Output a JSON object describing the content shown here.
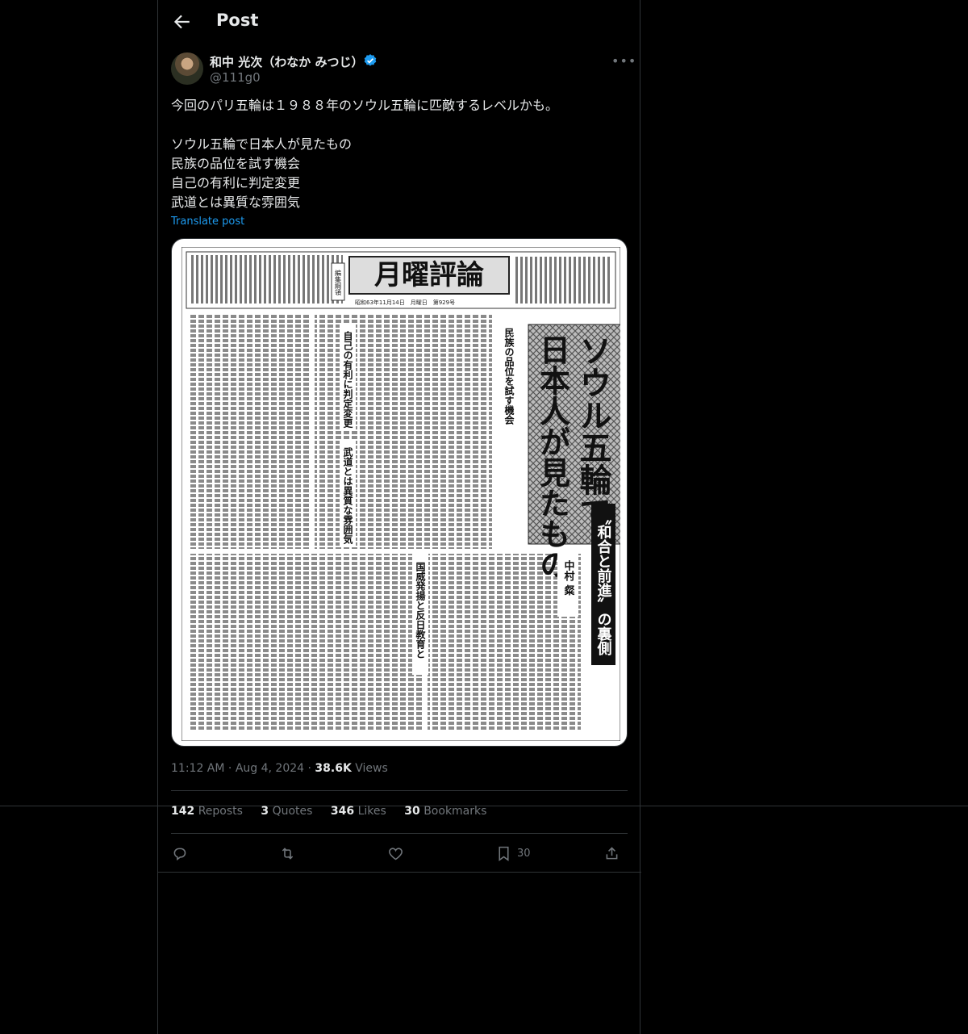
{
  "header": {
    "title": "Post"
  },
  "author": {
    "name": "和中 光次（わなか みつじ）",
    "handle": "@111g0"
  },
  "post": {
    "lines": [
      "今回のパリ五輪は１９８８年のソウル五輪に匹敵するレベルかも。",
      "",
      "ソウル五輪で日本人が見たもの",
      "民族の品位を試す機会",
      "自己の有利に判定変更",
      "武道とは異質な雰囲気"
    ],
    "translate_label": "Translate post"
  },
  "newspaper": {
    "masthead": "月曜評論",
    "headline_1": "ソウル五輪で",
    "headline_2": "日本人が見たもの",
    "sub_1": "民族の品位を試す機会",
    "sub_2": "自己の有利に判定変更",
    "sub_3": "武道とは異質な雰囲気",
    "sub_4": "国威発揚と反日教育と",
    "side": "〝和合と前進〟の裏側",
    "author": "中村 粲",
    "box_label": "編集綱領",
    "date_line": "昭和63年11月14日　月曜日　第929号"
  },
  "meta": {
    "time": "11:12 AM",
    "date": "Aug 4, 2024",
    "views_count": "38.6K",
    "views_label": "Views"
  },
  "stats": {
    "reposts_count": "142",
    "reposts_label": "Reposts",
    "quotes_count": "3",
    "quotes_label": "Quotes",
    "likes_count": "346",
    "likes_label": "Likes",
    "bookmarks_count": "30",
    "bookmarks_label": "Bookmarks"
  },
  "actions": {
    "bookmark_count": "30"
  },
  "colors": {
    "accent": "#1d9bf0",
    "background": "#000000",
    "border": "#2f3336",
    "muted": "#71767b"
  }
}
